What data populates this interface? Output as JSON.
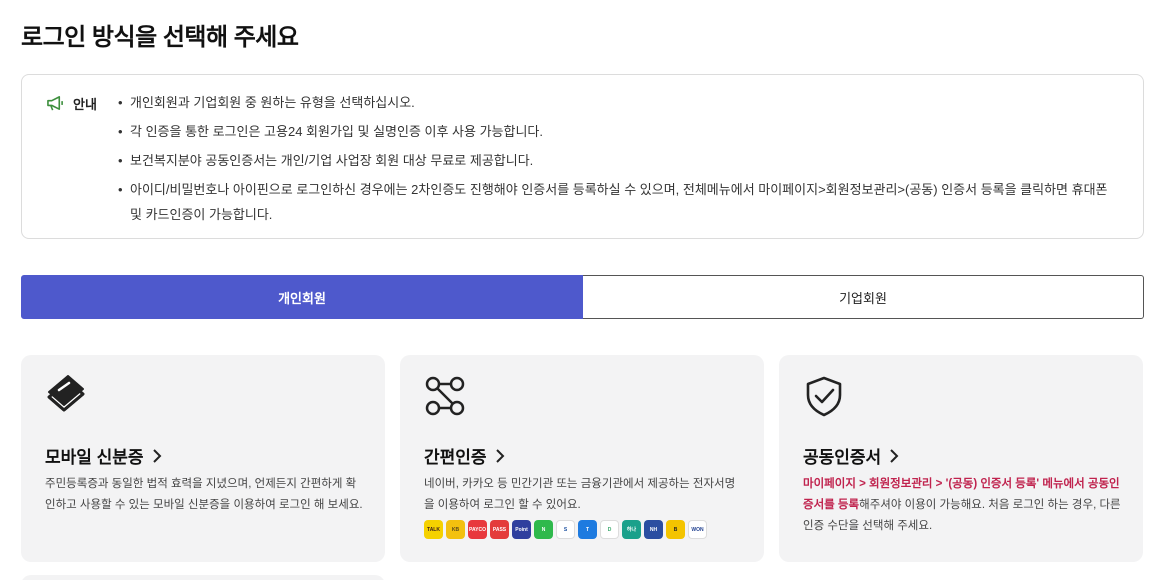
{
  "page": {
    "title": "로그인 방식을 선택해 주세요"
  },
  "notice": {
    "label": "안내",
    "items": [
      "개인회원과 기업회원 중 원하는 유형을 선택하십시오.",
      "각 인증을 통한 로그인은 고용24 회원가입 및 실명인증 이후 사용 가능합니다.",
      "보건복지분야 공동인증서는 개인/기업 사업장 회원 대상 무료로 제공합니다.",
      "아이디/비밀번호나 아이핀으로 로그인하신 경우에는 2차인증도 진행해야 인증서를 등록하실 수 있으며, 전체메뉴에서 마이페이지>회원정보관리>(공동) 인증서 등록을 클릭하면 휴대폰 및 카드인증이 가능합니다."
    ]
  },
  "tabs": [
    {
      "label": "개인회원",
      "active": true
    },
    {
      "label": "기업회원",
      "active": false
    }
  ],
  "cards": {
    "mobile_id": {
      "icon": "mobile-id-layers-icon",
      "title": "모바일 신분증",
      "desc": "주민등록증과 동일한 법적 효력을 지녔으며, 언제든지 간편하게 확인하고 사용할 수 있는 모바일 신분증을 이용하여 로그인 해 보세요."
    },
    "simple_auth": {
      "icon": "simple-auth-nodes-icon",
      "title": "간편인증",
      "desc": "네이버, 카카오 등 민간기관 또는 금융기관에서 제공하는 전자서명을 이용하여 로그인 할 수 있어요.",
      "providers": [
        {
          "name": "TALK",
          "color": "#f5d100",
          "text_color": "#3a1d1d"
        },
        {
          "name": "KB",
          "color": "#f3c10f",
          "text_color": "#5a4a1a"
        },
        {
          "name": "PAYCO",
          "color": "#e8383d",
          "text_color": "#ffffff"
        },
        {
          "name": "PASS",
          "color": "#e43b3b",
          "text_color": "#ffffff"
        },
        {
          "name": "Point",
          "color": "#2f3f9e",
          "text_color": "#ffffff"
        },
        {
          "name": "N",
          "color": "#2fb94c",
          "text_color": "#ffffff"
        },
        {
          "name": "S",
          "color": "#ffffff",
          "text_color": "#1a4fa0"
        },
        {
          "name": "T",
          "color": "#1e7be0",
          "text_color": "#ffffff"
        },
        {
          "name": "D",
          "color": "#ffffff",
          "text_color": "#39a86b"
        },
        {
          "name": "하나",
          "color": "#1aa08b",
          "text_color": "#ffffff"
        },
        {
          "name": "NH",
          "color": "#2b4ea1",
          "text_color": "#ffffff"
        },
        {
          "name": "B",
          "color": "#f4c400",
          "text_color": "#222222"
        },
        {
          "name": "WON",
          "color": "#ffffff",
          "text_color": "#1f3f8f"
        }
      ]
    },
    "cert": {
      "icon": "shield-check-icon",
      "title": "공동인증서",
      "desc_highlight": "마이페이지 > 회원정보관리 > '(공동) 인증서 등록' 메뉴에서 공동인증서를 등록",
      "desc_rest": "해주셔야 이용이 가능해요. 처음 로그인 하는 경우, 다른 인증 수단을 선택해 주세요."
    }
  },
  "colors": {
    "accent": "#4e59cc",
    "card_bg": "#f3f3f4",
    "highlight": "#c0234e"
  }
}
